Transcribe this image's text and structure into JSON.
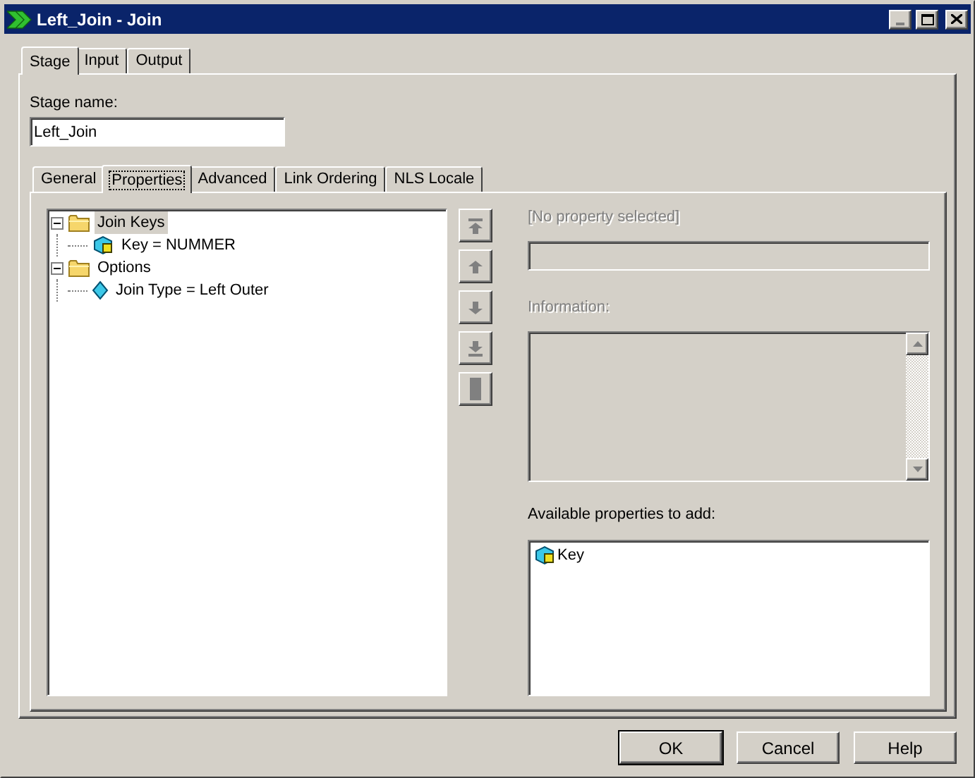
{
  "window": {
    "title": "Left_Join - Join"
  },
  "stage_tabs": [
    {
      "label": "Stage",
      "selected": true
    },
    {
      "label": "Input",
      "selected": false
    },
    {
      "label": "Output",
      "selected": false
    }
  ],
  "stage_name": {
    "label": "Stage name:",
    "value": "Left_Join"
  },
  "tabs": [
    {
      "label": "General",
      "selected": false
    },
    {
      "label": "Properties",
      "selected": true
    },
    {
      "label": "Advanced",
      "selected": false
    },
    {
      "label": "Link Ordering",
      "selected": false
    },
    {
      "label": "NLS Locale",
      "selected": false
    }
  ],
  "properties_tree": [
    {
      "label": "Join Keys",
      "kind": "folder",
      "expanded": true,
      "selected": true,
      "children": [
        {
          "label": "Key = NUMMER",
          "kind": "key",
          "selected": false
        }
      ]
    },
    {
      "label": "Options",
      "kind": "folder",
      "expanded": true,
      "selected": false,
      "children": [
        {
          "label": "Join Type = Left Outer",
          "kind": "option",
          "selected": false
        }
      ]
    }
  ],
  "order_buttons": [
    {
      "kind": "top",
      "disabled": true
    },
    {
      "kind": "up",
      "disabled": true
    },
    {
      "kind": "down",
      "disabled": true
    },
    {
      "kind": "bottom",
      "disabled": true
    },
    {
      "kind": "bar",
      "disabled": true
    }
  ],
  "property_label": {
    "text": "[No property selected]",
    "disabled": true
  },
  "property_field": {
    "disabled": true
  },
  "information": {
    "label": "Information:",
    "disabled": true
  },
  "available": {
    "label": "Available properties to add:",
    "items": [
      {
        "label": "Key",
        "kind": "key"
      }
    ]
  },
  "buttons": [
    {
      "label": "OK",
      "default": true
    },
    {
      "label": "Cancel",
      "default": false
    },
    {
      "label": "Help",
      "default": false
    }
  ]
}
